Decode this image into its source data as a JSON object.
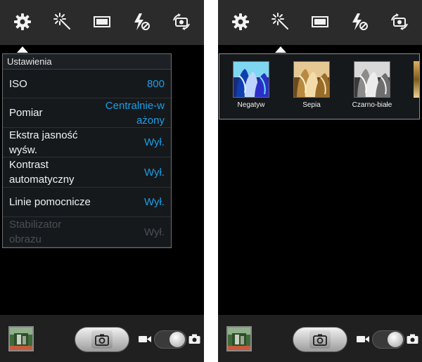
{
  "left_screen": {
    "toolbar": {
      "icons": [
        "gear-icon",
        "magic-wand-icon",
        "screen-frame-icon",
        "flash-off-icon",
        "switch-camera-icon"
      ],
      "active": "gear-icon"
    },
    "settings_panel": {
      "title": "Ustawienia",
      "rows": [
        {
          "label": "ISO",
          "value": "800",
          "enabled": true
        },
        {
          "label": "Pomiar",
          "value": "Centralnie-ważony",
          "value_lines": [
            "Centralnie-w",
            "ażony"
          ],
          "enabled": true
        },
        {
          "label": "Ekstra jasność wyśw.",
          "label_lines": [
            "Ekstra jasność",
            "wyśw."
          ],
          "value": "Wył.",
          "enabled": true
        },
        {
          "label": "Kontrast automatyczny",
          "label_lines": [
            "Kontrast",
            "automatyczny"
          ],
          "value": "Wył.",
          "enabled": true
        },
        {
          "label": "Linie pomocnicze",
          "value": "Wył.",
          "enabled": true
        },
        {
          "label": "Stabilizator obrazu",
          "label_lines": [
            "Stabilizator",
            "obrazu"
          ],
          "value": "Wył.",
          "enabled": false
        }
      ]
    }
  },
  "right_screen": {
    "toolbar": {
      "icons": [
        "gear-icon",
        "magic-wand-icon",
        "screen-frame-icon",
        "flash-off-icon",
        "switch-camera-icon"
      ],
      "active": "magic-wand-icon"
    },
    "effects": [
      {
        "label": "Negatyw",
        "thumb": "negative-thumbnail"
      },
      {
        "label": "Sepia",
        "thumb": "sepia-thumbnail"
      },
      {
        "label": "Czarno-białe",
        "thumb": "black-white-thumbnail"
      }
    ]
  },
  "bottom_bar": {
    "icons": [
      "gallery-thumbnail",
      "camera-icon",
      "video-icon",
      "photo-icon"
    ],
    "mode": "photo"
  },
  "colors": {
    "accent_blue": "#1a9ee6",
    "panel_bg": "#16191c",
    "bar_bg": "#2b2b2b"
  }
}
